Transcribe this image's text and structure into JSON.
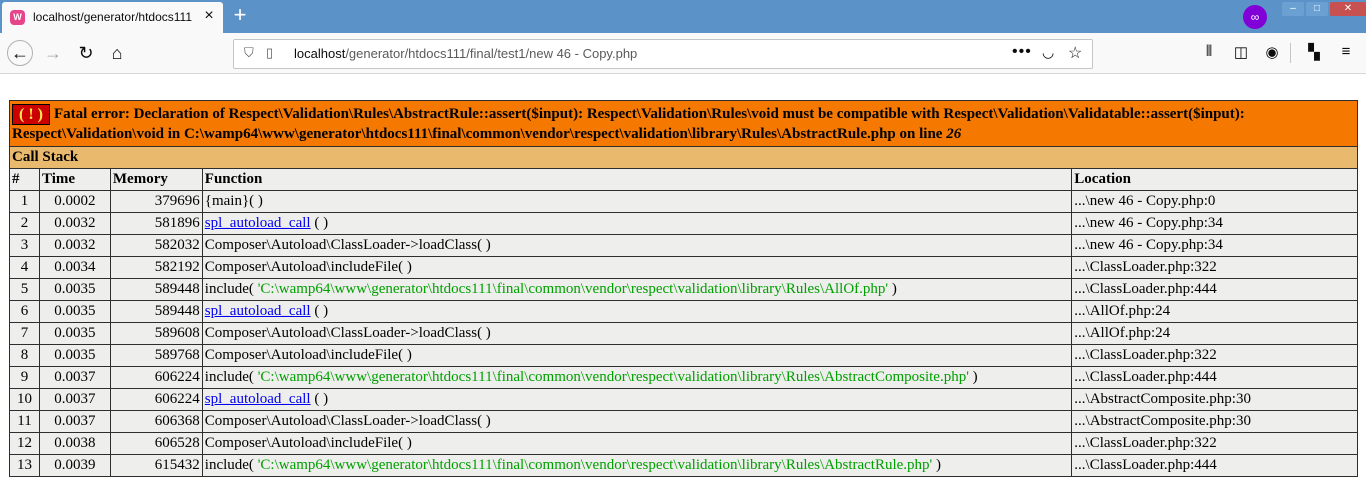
{
  "browser": {
    "tab_title": "localhost/generator/htdocs111",
    "tab_favicon": "wamp-icon",
    "url_host": "localhost",
    "url_path": "/generator/htdocs111/final/test1/new 46 - Copy.php",
    "accent": "#5b92c8"
  },
  "error": {
    "badge": "( ! )",
    "message": "Fatal error: Declaration of Respect\\Validation\\Rules\\AbstractRule::assert($input): Respect\\Validation\\Rules\\void must be compatible with Respect\\Validation\\Validatable::assert($input): Respect\\Validation\\void in C:\\wamp64\\www\\generator\\htdocs111\\final\\common\\vendor\\respect\\validation\\library\\Rules\\AbstractRule.php on line ",
    "line": "26",
    "call_stack_label": "Call Stack",
    "columns": [
      "#",
      "Time",
      "Memory",
      "Function",
      "Location"
    ],
    "rows": [
      {
        "n": "1",
        "time": "0.0002",
        "mem": "379696",
        "fn": "{main}( )",
        "fn_link": "",
        "fn_arg": "",
        "loc": "...\\new 46 - Copy.php:0"
      },
      {
        "n": "2",
        "time": "0.0032",
        "mem": "581896",
        "fn": "",
        "fn_link": "spl_autoload_call",
        "fn_arg": "",
        "loc": "...\\new 46 - Copy.php:34"
      },
      {
        "n": "3",
        "time": "0.0032",
        "mem": "582032",
        "fn": "Composer\\Autoload\\ClassLoader->loadClass( )",
        "fn_link": "",
        "fn_arg": "",
        "loc": "...\\new 46 - Copy.php:34"
      },
      {
        "n": "4",
        "time": "0.0034",
        "mem": "582192",
        "fn": "Composer\\Autoload\\includeFile( )",
        "fn_link": "",
        "fn_arg": "",
        "loc": "...\\ClassLoader.php:322"
      },
      {
        "n": "5",
        "time": "0.0035",
        "mem": "589448",
        "fn": "",
        "fn_link": "",
        "fn_arg": "'C:\\wamp64\\www\\generator\\htdocs111\\final\\common\\vendor\\respect\\validation\\library\\Rules\\AllOf.php'",
        "loc": "...\\ClassLoader.php:444"
      },
      {
        "n": "6",
        "time": "0.0035",
        "mem": "589448",
        "fn": "",
        "fn_link": "spl_autoload_call",
        "fn_arg": "",
        "loc": "...\\AllOf.php:24"
      },
      {
        "n": "7",
        "time": "0.0035",
        "mem": "589608",
        "fn": "Composer\\Autoload\\ClassLoader->loadClass( )",
        "fn_link": "",
        "fn_arg": "",
        "loc": "...\\AllOf.php:24"
      },
      {
        "n": "8",
        "time": "0.0035",
        "mem": "589768",
        "fn": "Composer\\Autoload\\includeFile( )",
        "fn_link": "",
        "fn_arg": "",
        "loc": "...\\ClassLoader.php:322"
      },
      {
        "n": "9",
        "time": "0.0037",
        "mem": "606224",
        "fn": "",
        "fn_link": "",
        "fn_arg": "'C:\\wamp64\\www\\generator\\htdocs111\\final\\common\\vendor\\respect\\validation\\library\\Rules\\AbstractComposite.php'",
        "loc": "...\\ClassLoader.php:444"
      },
      {
        "n": "10",
        "time": "0.0037",
        "mem": "606224",
        "fn": "",
        "fn_link": "spl_autoload_call",
        "fn_arg": "",
        "loc": "...\\AbstractComposite.php:30"
      },
      {
        "n": "11",
        "time": "0.0037",
        "mem": "606368",
        "fn": "Composer\\Autoload\\ClassLoader->loadClass( )",
        "fn_link": "",
        "fn_arg": "",
        "loc": "...\\AbstractComposite.php:30"
      },
      {
        "n": "12",
        "time": "0.0038",
        "mem": "606528",
        "fn": "Composer\\Autoload\\includeFile( )",
        "fn_link": "",
        "fn_arg": "",
        "loc": "...\\ClassLoader.php:322"
      },
      {
        "n": "13",
        "time": "0.0039",
        "mem": "615432",
        "fn": "",
        "fn_link": "",
        "fn_arg": "'C:\\wamp64\\www\\generator\\htdocs111\\final\\common\\vendor\\respect\\validation\\library\\Rules\\AbstractRule.php'",
        "loc": "...\\ClassLoader.php:444"
      }
    ],
    "include_prefix": "include( ",
    "include_suffix": " )",
    "call_suffix": " ( )",
    "colors": {
      "error_bg": "#f57900",
      "callstack_bg": "#e9b96e",
      "cell_bg": "#eeeeec",
      "arg_color": "#00a000"
    }
  }
}
